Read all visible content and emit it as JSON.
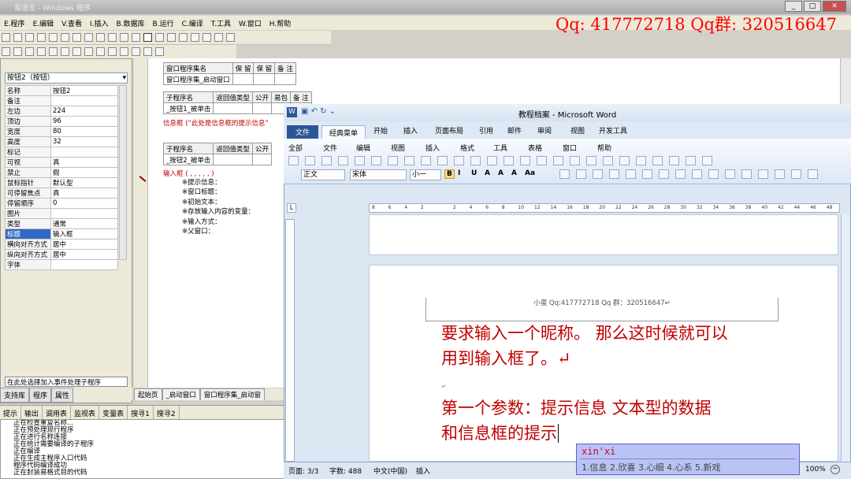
{
  "app": {
    "title": "易语言 - Windows 程序",
    "menu": [
      "E.程序",
      "E.编辑",
      "V.查看",
      "I.插入",
      "B.数据库",
      "B.运行",
      "C.编译",
      "T.工具",
      "W.窗口",
      "H.帮助"
    ],
    "watermark": "Qq: 417772718  Qq群: 320516647"
  },
  "props_panel": {
    "selector": "按钮2（按钮）",
    "rows": [
      {
        "k": "名称",
        "v": "按钮2"
      },
      {
        "k": "备注",
        "v": ""
      },
      {
        "k": "左边",
        "v": "224"
      },
      {
        "k": "顶边",
        "v": "96"
      },
      {
        "k": "宽度",
        "v": "80"
      },
      {
        "k": "高度",
        "v": "32"
      },
      {
        "k": "标记",
        "v": ""
      },
      {
        "k": "可视",
        "v": "真"
      },
      {
        "k": "禁止",
        "v": "假"
      },
      {
        "k": "鼠标指针",
        "v": "默认型"
      },
      {
        "k": "可停留焦点",
        "v": "真"
      },
      {
        "k": "停留顺序",
        "v": "0"
      },
      {
        "k": "图片",
        "v": ""
      },
      {
        "k": "类型",
        "v": "通常"
      },
      {
        "k": "标题",
        "v": "输入框"
      },
      {
        "k": "横向对齐方式",
        "v": "居中"
      },
      {
        "k": "纵向对齐方式",
        "v": "居中"
      },
      {
        "k": "字体",
        "v": ""
      }
    ],
    "event_hint": "在此处选择加入事件处理子程序",
    "tabs": [
      "支持库",
      "程序",
      "属性"
    ]
  },
  "code": {
    "t1_headers": [
      "窗口程序集名",
      "保 留",
      "保 留",
      "备 注"
    ],
    "t1_row": "窗口程序集_启动窗口",
    "t2_headers": [
      "子程序名",
      "返回值类型",
      "公开",
      "易包",
      "备 注"
    ],
    "t2_row": "_按钮1_被单击",
    "msgbox_line": "信息框 (“此处是信息框的提示信息”",
    "t3_headers": [
      "子程序名",
      "返回值类型",
      "公开"
    ],
    "t3_row": "_按钮2_被单击",
    "input_line": "输入框 ( , , , , , )",
    "params": [
      "※提示信息：",
      "※窗口标题：",
      "※初始文本：",
      "※存放输入内容的变量：",
      "※输入方式：",
      "※父窗口："
    ],
    "tabs": [
      "起始页",
      "_启动窗口",
      "窗口程序集_启动窗"
    ]
  },
  "output": {
    "tabs": [
      "提示",
      "输出",
      "调用表",
      "监视表",
      "变量表",
      "搜寻1",
      "搜寻2"
    ],
    "lines": [
      "正在检查重复名称...",
      "正在预处理现行程序",
      "正在进行名称连接",
      "正在统计需要编译的子程序",
      "正在编译",
      "正在生成主程序入口代码",
      "程序代码编译成功",
      "正在封装易格式目的代码"
    ]
  },
  "word": {
    "title": "教程档案 - Microsoft Word",
    "tabs": [
      "文件",
      "经典菜单",
      "开始",
      "插入",
      "页面布局",
      "引用",
      "邮件",
      "审阅",
      "视图",
      "开发工具"
    ],
    "classic_menu": [
      "全部",
      "文件",
      "编辑",
      "视图",
      "插入",
      "格式",
      "工具",
      "表格",
      "窗口",
      "帮助"
    ],
    "style": "正文",
    "font": "宋体",
    "size": "小一",
    "ruler_nums": [
      "8",
      "6",
      "4",
      "2",
      "",
      "2",
      "4",
      "6",
      "8",
      "10",
      "12",
      "14",
      "16",
      "18",
      "20",
      "22",
      "24",
      "26",
      "28",
      "30",
      "32",
      "34",
      "36",
      "38",
      "40",
      "42",
      "44",
      "46",
      "48"
    ],
    "header_text": "小蛋 Qq:417772718    Qq 群：320516647↵",
    "para1": [
      "要求输入一个昵称。 那么这时候就可以",
      "用到输入框了。↵"
    ],
    "para2": [
      "第一个参数：提示信息   文本型的数据",
      "和信息框的提示"
    ],
    "status": {
      "page": "页面: 3/3",
      "words": "字数: 488",
      "lang": "中文(中国)",
      "mode": "插入",
      "zoom": "100%"
    }
  },
  "ime": {
    "pinyin": "xin'xi",
    "candidates": "1.信息  2.欣喜  3.心细  4.心系  5.新戏"
  }
}
